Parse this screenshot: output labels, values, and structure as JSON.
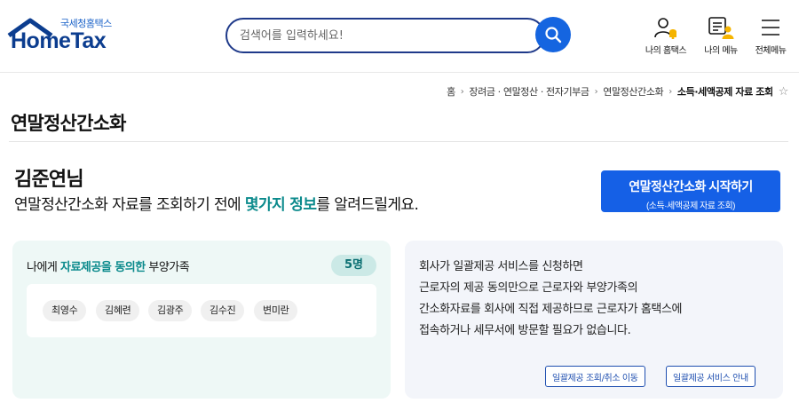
{
  "brand": {
    "sub": "국세청홈택스",
    "main": "HomeTax"
  },
  "search": {
    "placeholder": "검색어를 입력하세요!"
  },
  "header_nav": [
    {
      "label": "나의 홈택스",
      "icon": "person-bell-icon"
    },
    {
      "label": "나의 메뉴",
      "icon": "menu-person-icon"
    },
    {
      "label": "전체메뉴",
      "icon": "hamburger-icon"
    }
  ],
  "breadcrumb": {
    "items": [
      "홈",
      "장려금 · 연말정산 · 전자기부금",
      "연말정산간소화"
    ],
    "current": "소득·세액공제 자료 조회"
  },
  "page": {
    "title": "연말정산간소화"
  },
  "greeting": {
    "name": "김준연님",
    "msg_before": "연말정산간소화 자료를 조회하기 전에 ",
    "msg_highlight": "몇가지 정보",
    "msg_after": "를 알려드릴게요."
  },
  "start_button": {
    "label": "연말정산간소화 시작하기",
    "sublabel": "(소득·세액공제 자료 조회)"
  },
  "dependents_card": {
    "title_before": "나에게 ",
    "title_highlight": "자료제공을 동의한",
    "title_after": " 부양가족",
    "count": "5명",
    "members": [
      "최영수",
      "김혜련",
      "김광주",
      "김수진",
      "변미란"
    ]
  },
  "info_card": {
    "lines": [
      "회사가 일괄제공 서비스를 신청하면",
      "근로자의 제공 동의만으로 근로자와 부양가족의",
      "간소화자료를 회사에 직접 제공하므로 근로자가 홈택스에",
      "접속하거나 세무서에 방문할 필요가 없습니다."
    ],
    "buttons": [
      "일괄제공 조회/취소 이동",
      "일괄제공 서비스 안내"
    ]
  },
  "colors": {
    "primary": "#1560e6",
    "teal": "#0b8a8c",
    "navy": "#0c3d8f"
  }
}
